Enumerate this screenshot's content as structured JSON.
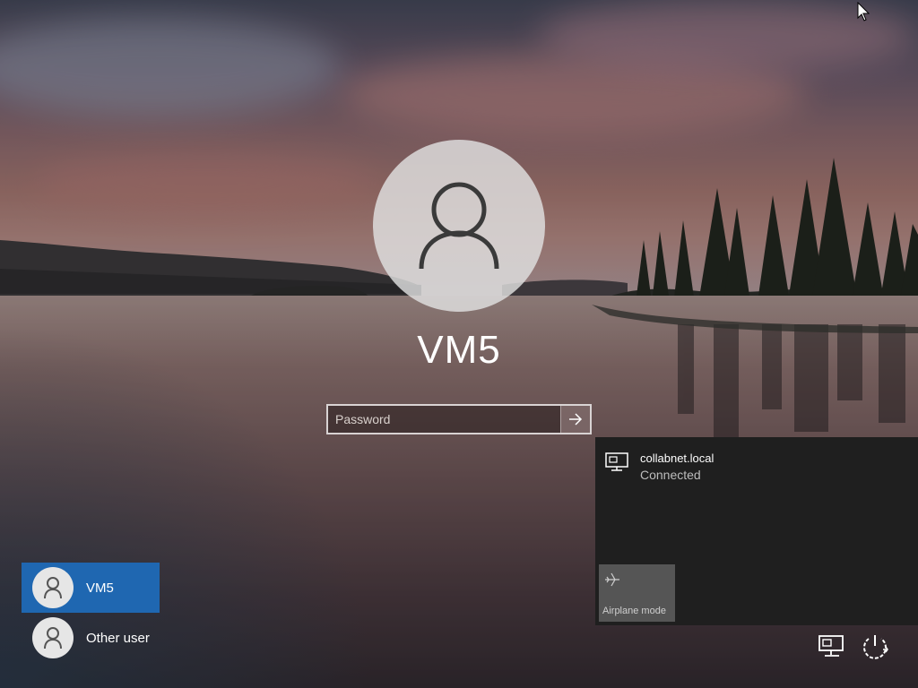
{
  "lock_screen": {
    "username": "VM5",
    "password_placeholder": "Password"
  },
  "user_list": [
    {
      "name": "VM5",
      "selected": true
    },
    {
      "name": "Other user",
      "selected": false
    }
  ],
  "network_flyout": {
    "network_name": "collabnet.local",
    "status": "Connected",
    "airplane_tile_label": "Airplane mode"
  },
  "tray": {
    "icons": [
      "network-icon",
      "power-icon"
    ]
  },
  "colors": {
    "selected_user": "#1f67b1",
    "flyout_bg": "#1f1f1f",
    "tile_bg": "#555555"
  }
}
